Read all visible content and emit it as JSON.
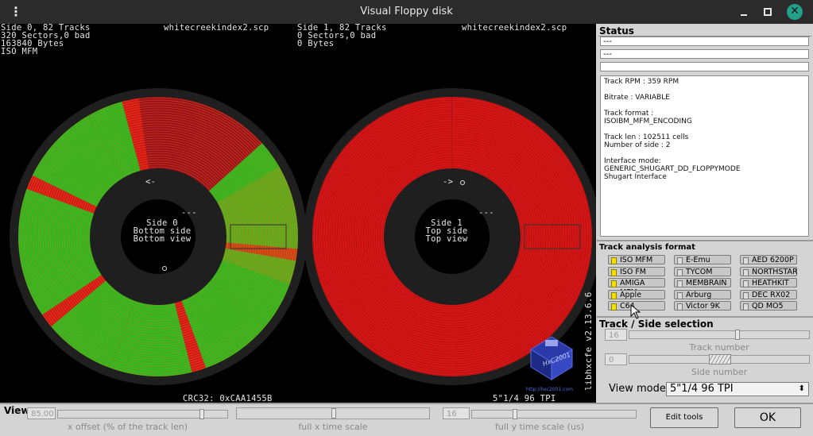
{
  "window": {
    "title": "Visual Floppy disk",
    "menu_icon": "kebab-menu-icon",
    "min_icon": "minimize-icon",
    "max_icon": "maximize-icon",
    "close_icon": "close-icon",
    "close_label": "✕"
  },
  "side0": {
    "line1": "Side 0, 82 Tracks",
    "line2": "320 Sectors,0 bad",
    "line3": "163840 Bytes",
    "line4": "ISO MFM",
    "filename": "whitecreekindex2.scp",
    "center1": "Side 0",
    "center2": "Bottom side",
    "center3": "Bottom view",
    "arrow": "<-",
    "crc": "CRC32: 0xCAA1455B"
  },
  "side1": {
    "line1": "Side 1, 82 Tracks",
    "line2": "0 Sectors,0 bad",
    "line3": "0 Bytes",
    "filename": "whitecreekindex2.scp",
    "center1": "Side 1",
    "center2": "Top side",
    "center3": "Top view",
    "arrow": "->",
    "density": "5\"1/4 96 TPI"
  },
  "canvas": {
    "version": "libhxcfe v2.13.6.6",
    "logo_text": "HxC2001",
    "logo_url": "http://hxc2001.com",
    "colors": {
      "good": "#2fb51f",
      "bad": "#d61616",
      "dark_bad": "#a0101a",
      "disk": "#1f1f1f"
    }
  },
  "status": {
    "title": "Status",
    "field1": "---",
    "field2": "---",
    "field3": "",
    "info": [
      "Track RPM : 359 RPM",
      "",
      "Bitrate : VARIABLE",
      "",
      "Track format :",
      "ISOIBM_MFM_ENCODING",
      "",
      "Track len : 102511 cells",
      "Number of side : 2",
      "",
      "Interface mode:",
      "GENERIC_SHUGART_DD_FLOPPYMODE",
      "Shugart Interface"
    ]
  },
  "track_analysis": {
    "title": "Track analysis format",
    "formats": [
      {
        "label": "ISO MFM",
        "on": true
      },
      {
        "label": "E-Emu",
        "on": false
      },
      {
        "label": "AED 6200P",
        "on": false
      },
      {
        "label": "ISO FM",
        "on": true
      },
      {
        "label": "TYCOM",
        "on": false
      },
      {
        "label": "NORTHSTAR",
        "on": false
      },
      {
        "label": "AMIGA MFM",
        "on": true
      },
      {
        "label": "MEMBRAIN",
        "on": false
      },
      {
        "label": "HEATHKIT",
        "on": false
      },
      {
        "label": "Apple",
        "on": true
      },
      {
        "label": "Arburg",
        "on": false
      },
      {
        "label": "DEC RX02",
        "on": false
      },
      {
        "label": "C64",
        "on": true
      },
      {
        "label": "Victor 9K",
        "on": false
      },
      {
        "label": "QD MO5",
        "on": false
      }
    ]
  },
  "track_side": {
    "title": "Track / Side selection",
    "track_value": "16",
    "track_caption": "Track number",
    "side_value": "0",
    "side_caption": "Side number",
    "view_mode_label": "View mode",
    "view_mode_value": "5\"1/4 96 TPI",
    "track_position": 0.6,
    "side_position": 0.5
  },
  "view": {
    "title": "View",
    "x_offset_value": "85.00",
    "x_offset_caption": "x offset (% of the track len)",
    "x_offset_position": 0.85,
    "x_time_caption": "full x time scale",
    "x_time_position": 0.5,
    "y_time_value": "16",
    "y_time_caption": "full y time scale (us)",
    "y_time_position": 0.25,
    "edit_tools_label": "Edit tools",
    "ok_label": "OK"
  }
}
